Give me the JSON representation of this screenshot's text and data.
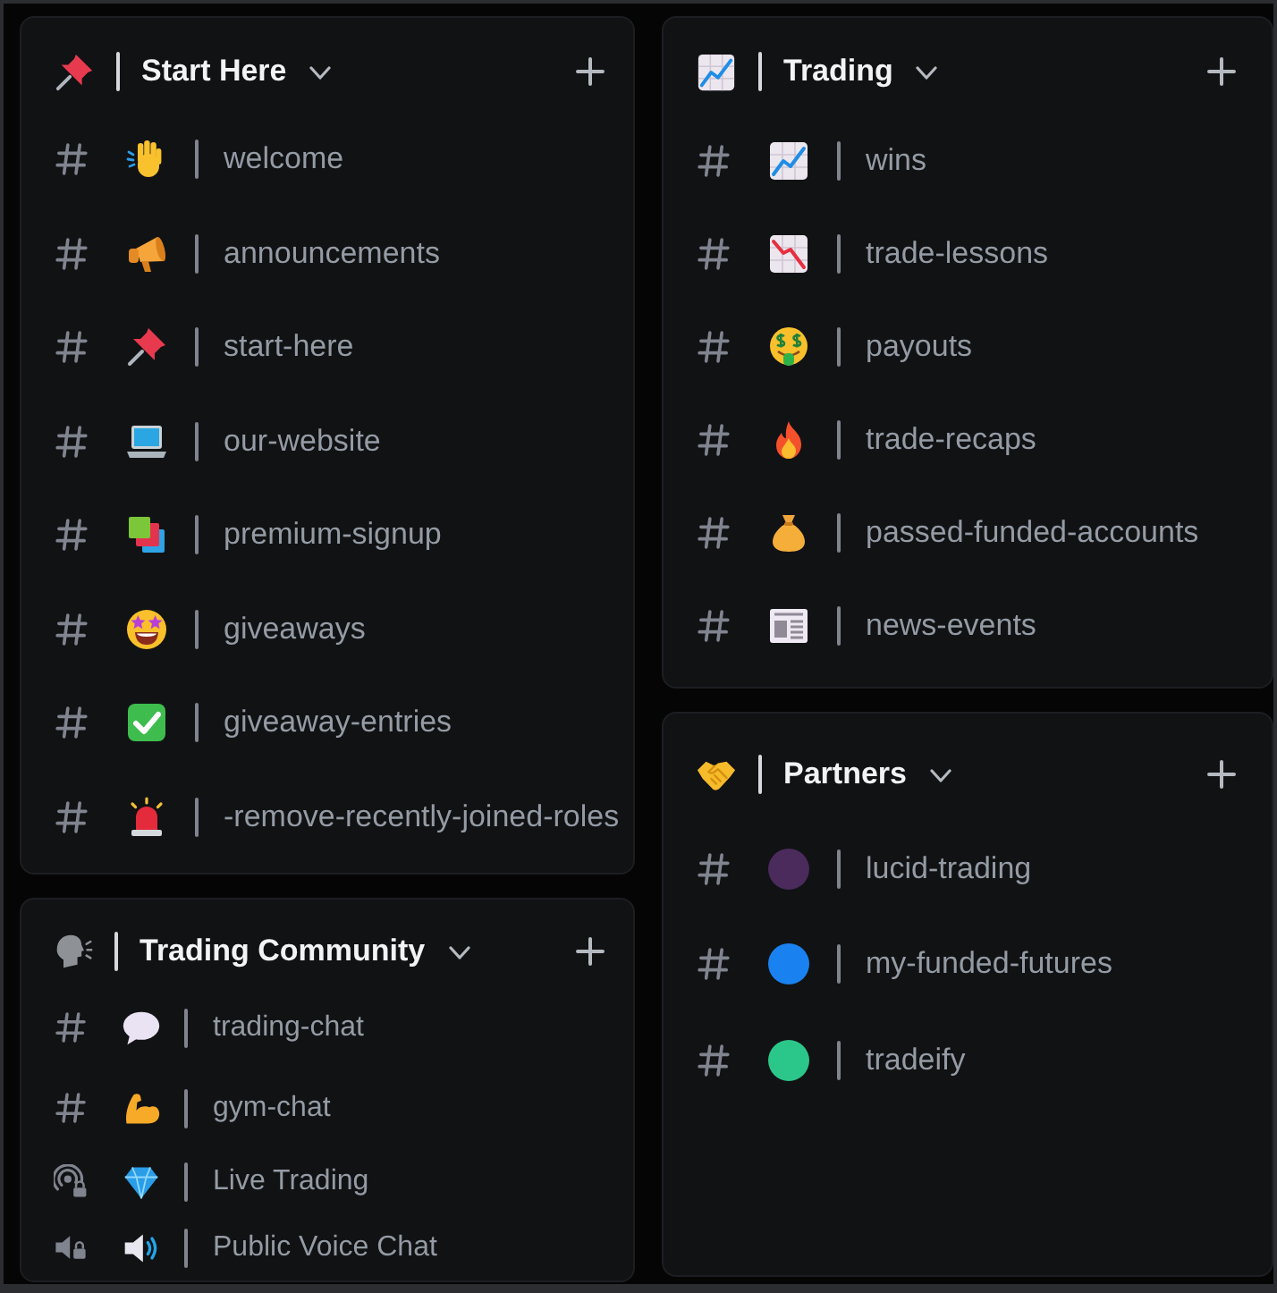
{
  "columns": [
    {
      "categories": [
        {
          "name": "Start Here",
          "expanded": true,
          "channels": [
            {
              "kind": "text",
              "name": "welcome"
            },
            {
              "kind": "text",
              "name": "announcements"
            },
            {
              "kind": "text",
              "name": "start-here"
            },
            {
              "kind": "text",
              "name": "our-website"
            },
            {
              "kind": "text",
              "name": "premium-signup"
            },
            {
              "kind": "text",
              "name": "giveaways"
            },
            {
              "kind": "text",
              "name": "giveaway-entries"
            },
            {
              "kind": "text",
              "name": "-remove-recently-joined-roles"
            }
          ]
        },
        {
          "name": "Trading Community",
          "expanded": true,
          "channels": [
            {
              "kind": "text",
              "name": "trading-chat"
            },
            {
              "kind": "text",
              "name": "gym-chat"
            },
            {
              "kind": "stage",
              "name": "Live Trading"
            },
            {
              "kind": "voice",
              "name": "Public Voice Chat"
            }
          ]
        }
      ]
    },
    {
      "categories": [
        {
          "name": "Trading",
          "expanded": true,
          "channels": [
            {
              "kind": "text",
              "name": "wins"
            },
            {
              "kind": "text",
              "name": "trade-lessons"
            },
            {
              "kind": "text",
              "name": "payouts"
            },
            {
              "kind": "text",
              "name": "trade-recaps"
            },
            {
              "kind": "text",
              "name": "passed-funded-accounts"
            },
            {
              "kind": "text",
              "name": "news-events"
            }
          ]
        },
        {
          "name": "Partners",
          "expanded": true,
          "channels": [
            {
              "kind": "text",
              "name": "lucid-trading",
              "color": "#4a2b5c"
            },
            {
              "kind": "text",
              "name": "my-funded-futures",
              "color": "#1a82f0"
            },
            {
              "kind": "text",
              "name": "tradeify",
              "color": "#2bc78a"
            }
          ]
        }
      ]
    }
  ]
}
